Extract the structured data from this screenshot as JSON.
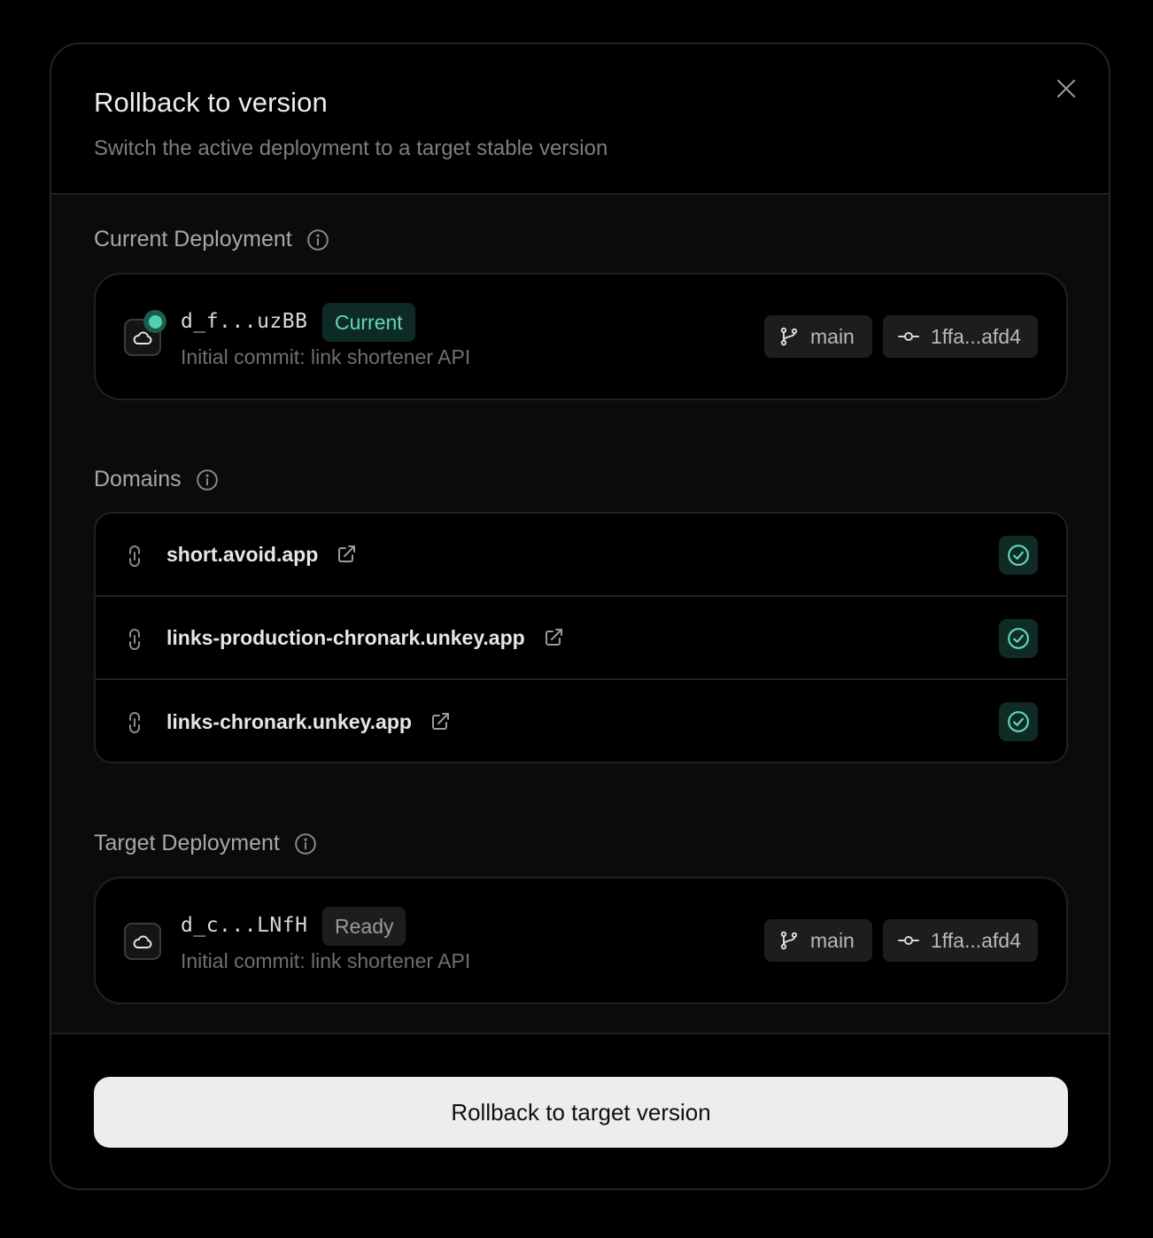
{
  "modal": {
    "title": "Rollback to version",
    "subtitle": "Switch the active deployment to a target stable version"
  },
  "current_deployment": {
    "label": "Current Deployment",
    "id": "d_f...uzBB",
    "badge": "Current",
    "message": "Initial commit: link shortener API",
    "branch": "main",
    "commit": "1ffa...afd4",
    "status_color": "#4fd1b1"
  },
  "domains": {
    "label": "Domains",
    "items": [
      {
        "name": "short.avoid.app",
        "status": "verified"
      },
      {
        "name": "links-production-chronark.unkey.app",
        "status": "verified"
      },
      {
        "name": "links-chronark.unkey.app",
        "status": "verified"
      }
    ]
  },
  "target_deployment": {
    "label": "Target Deployment",
    "id": "d_c...LNfH",
    "badge": "Ready",
    "message": "Initial commit: link shortener API",
    "branch": "main",
    "commit": "1ffa...afd4"
  },
  "footer": {
    "button_label": "Rollback to target version"
  },
  "colors": {
    "accent_green": "#62d7b4",
    "background": "#000000",
    "button_bg": "#ededee"
  }
}
